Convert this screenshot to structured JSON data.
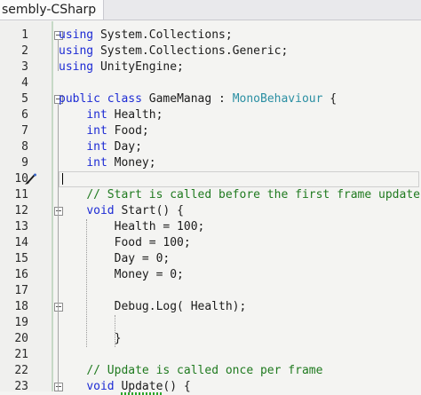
{
  "tab": {
    "title": "sembly-CSharp"
  },
  "lines": [
    {
      "n": "1",
      "code": "using System.Collections;"
    },
    {
      "n": "2",
      "code": "using System.Collections.Generic;"
    },
    {
      "n": "3",
      "code": "using UnityEngine;"
    },
    {
      "n": "4",
      "code": ""
    },
    {
      "n": "5",
      "code": "public class GameManag : MonoBehaviour {"
    },
    {
      "n": "6",
      "code": "    int Health;"
    },
    {
      "n": "7",
      "code": "    int Food;"
    },
    {
      "n": "8",
      "code": "    int Day;"
    },
    {
      "n": "9",
      "code": "    int Money;"
    },
    {
      "n": "10",
      "code": ""
    },
    {
      "n": "11",
      "code": "    // Start is called before the first frame update"
    },
    {
      "n": "12",
      "code": "    void Start() {"
    },
    {
      "n": "13",
      "code": "        Health = 100;"
    },
    {
      "n": "14",
      "code": "        Food = 100;"
    },
    {
      "n": "15",
      "code": "        Day = 0;"
    },
    {
      "n": "16",
      "code": "        Money = 0;"
    },
    {
      "n": "17",
      "code": ""
    },
    {
      "n": "18",
      "code": "        Debug.Log( Health);"
    },
    {
      "n": "19",
      "code": ""
    },
    {
      "n": "20",
      "code": "        }"
    },
    {
      "n": "21",
      "code": ""
    },
    {
      "n": "22",
      "code": "    // Update is called once per frame"
    },
    {
      "n": "23",
      "code": "    void Update() {"
    }
  ],
  "colors": {
    "keyword": "#1d2bd4",
    "type": "#2b8fa3",
    "comment": "#1f7a1f",
    "text": "#1b1b1b"
  },
  "icons": {
    "fold": "fold-toggle-icon",
    "quick_action": "paintbrush-icon"
  }
}
